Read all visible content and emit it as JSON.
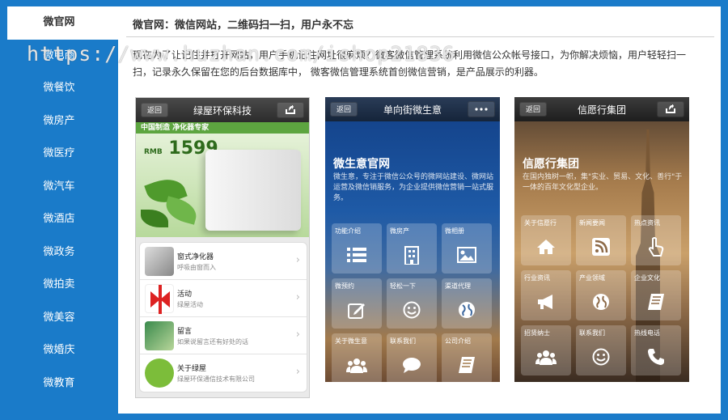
{
  "watermark": "https://www.huzhan.com/ishop21836",
  "sidebar": {
    "items": [
      {
        "label": "微官网",
        "active": true
      },
      {
        "label": "微电商"
      },
      {
        "label": "微餐饮"
      },
      {
        "label": "微房产"
      },
      {
        "label": "微医疗"
      },
      {
        "label": "微汽车"
      },
      {
        "label": "微酒店"
      },
      {
        "label": "微政务"
      },
      {
        "label": "微拍卖"
      },
      {
        "label": "微美容"
      },
      {
        "label": "微婚庆"
      },
      {
        "label": "微教育"
      }
    ]
  },
  "main": {
    "title": "微官网：微信网站，二维码扫一扫，用户永不忘",
    "description": "现在为了让记住并打开网站，用户手机记住网址很麻烦？微客微信管理系统利用微信公众帐号接口，为你解决烦恼，用户轻轻扫一扫，记录永久保留在您的后台数据库中， 微客微信管理系统首创微信营销，是产品展示的利器。"
  },
  "phones": [
    {
      "back_label": "返回",
      "title": "绿屋环保科技",
      "banner": {
        "strip": "中国制造 净化器专家",
        "price": "1599",
        "currency": "RMB"
      },
      "list": [
        {
          "title": "窗式净化器",
          "sub": "呼吸由窗而入"
        },
        {
          "title": "活动",
          "sub": "绿屋活动"
        },
        {
          "title": "留言",
          "sub": "如果说留言还有好处的话"
        },
        {
          "title": "关于绿屋",
          "sub": "绿屋环保通信技术有限公司"
        }
      ]
    },
    {
      "back_label": "返回",
      "title": "单向街微生意",
      "hero_title": "微生意官网",
      "hero_desc": "微生意，专注于微信公众号的微网站建设、微网站运营及微信销服务，为企业提供微信营销一站式服务。",
      "tiles": [
        {
          "label": "功能介绍",
          "icon": "list-icon"
        },
        {
          "label": "微房产",
          "icon": "building-icon"
        },
        {
          "label": "微相册",
          "icon": "picture-icon"
        },
        {
          "label": "微预约",
          "icon": "edit-icon"
        },
        {
          "label": "轻松一下",
          "icon": "smile-icon"
        },
        {
          "label": "渠道代理",
          "icon": "globe-icon"
        },
        {
          "label": "关于微生意",
          "icon": "users-icon"
        },
        {
          "label": "联系我们",
          "icon": "chat-icon"
        },
        {
          "label": "公司介绍",
          "icon": "book-icon"
        }
      ]
    },
    {
      "back_label": "返回",
      "title": "信愿行集团",
      "hero_title": "信愿行集团",
      "hero_desc": "在国内独树一帜，集\"实业、贸易、文化、善行\"于一体的百年文化型企业。",
      "tiles": [
        {
          "label": "关于信愿行",
          "icon": "home-icon"
        },
        {
          "label": "新闻要闻",
          "icon": "rss-icon"
        },
        {
          "label": "热点资讯",
          "icon": "pointer-icon"
        },
        {
          "label": "行业资讯",
          "icon": "megaphone-icon"
        },
        {
          "label": "产业领域",
          "icon": "globe-icon"
        },
        {
          "label": "企业文化",
          "icon": "book-icon"
        },
        {
          "label": "招贤纳士",
          "icon": "users-icon"
        },
        {
          "label": "联系我们",
          "icon": "smile-icon"
        },
        {
          "label": "热线电话",
          "icon": "phone-icon"
        }
      ]
    }
  ]
}
